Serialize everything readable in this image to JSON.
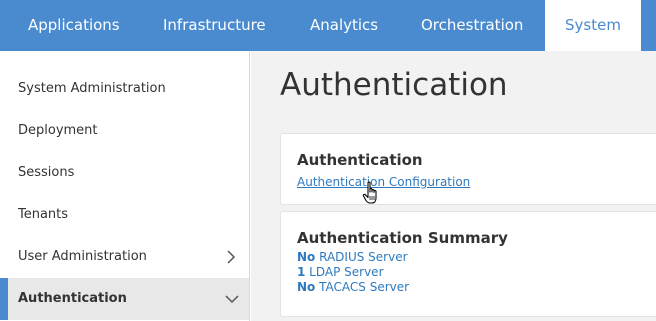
{
  "nav": {
    "tabs": [
      {
        "label": "Applications"
      },
      {
        "label": "Infrastructure"
      },
      {
        "label": "Analytics"
      },
      {
        "label": "Orchestration"
      },
      {
        "label": "System"
      }
    ],
    "active": "System"
  },
  "sidebar": {
    "items": [
      {
        "label": "System Administration"
      },
      {
        "label": "Deployment"
      },
      {
        "label": "Sessions"
      },
      {
        "label": "Tenants"
      },
      {
        "label": "User Administration"
      },
      {
        "label": "Authentication"
      }
    ]
  },
  "main": {
    "title": "Authentication",
    "auth_card": {
      "title": "Authentication",
      "link": "Authentication Configuration"
    },
    "summary_card": {
      "title": "Authentication Summary",
      "rows": [
        {
          "count": "No",
          "text": " RADIUS Server"
        },
        {
          "count": "1",
          "text": " LDAP Server"
        },
        {
          "count": "No",
          "text": " TACACS Server"
        }
      ]
    }
  },
  "colors": {
    "accent": "#4a8bd0",
    "link": "#2f7abf"
  }
}
